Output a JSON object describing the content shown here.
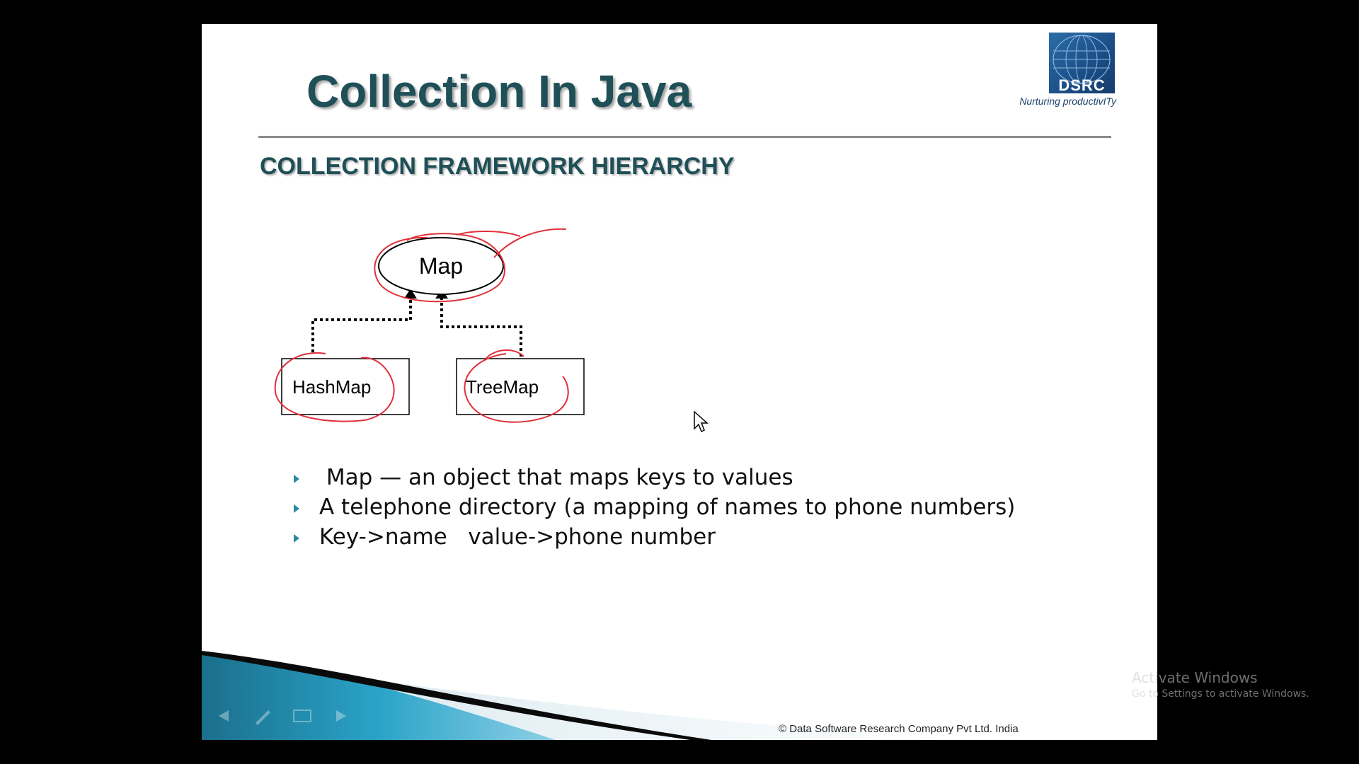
{
  "slide": {
    "title": "Collection In Java",
    "section_heading": "COLLECTION FRAMEWORK HIERARCHY",
    "logo": {
      "name": "DSRC",
      "tagline": "Nurturing productivITy"
    },
    "diagram": {
      "root": "Map",
      "children": [
        "HashMap",
        "TreeMap"
      ]
    },
    "bullets": [
      " Map — an object that maps keys to values",
      "A telephone directory (a mapping of names to phone numbers)",
      "Key->name   value->phone number"
    ],
    "copyright": "© Data Software Research Company Pvt Ltd. India"
  },
  "watermark": {
    "title": "Activate Windows",
    "subtitle": "Go to Settings to activate Windows."
  },
  "colors": {
    "title": "#1f4f57",
    "annotation": "#e0303a",
    "bullet": "#2a8aa0",
    "swoosh": "#1e8ab0"
  },
  "icons": {
    "nav": [
      "back-arrow-icon",
      "pen-icon",
      "slides-menu-icon",
      "forward-icon"
    ],
    "cursor": "mouse-pointer-icon"
  }
}
